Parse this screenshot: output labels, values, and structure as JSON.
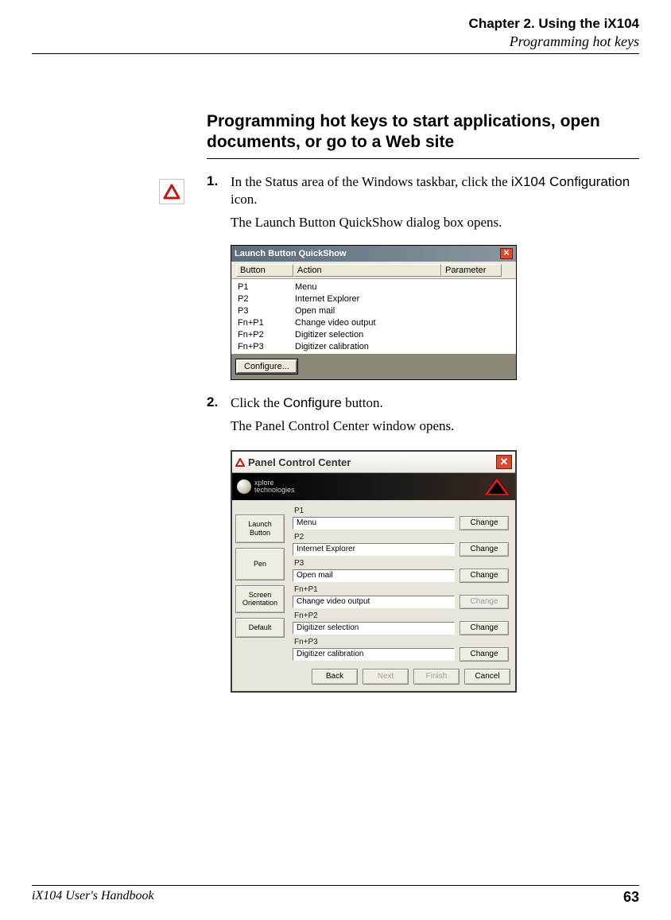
{
  "header": {
    "chapter": "Chapter 2. Using the iX104",
    "section": "Programming hot keys"
  },
  "title": "Programming hot keys to start applications, open documents, or go to a Web site",
  "steps": {
    "s1": {
      "num": "1.",
      "text_a": "In the Status area of the Windows taskbar, click the ",
      "text_b": "iX104 Configuration",
      "text_c": " icon.",
      "result": "The Launch Button QuickShow dialog box opens."
    },
    "s2": {
      "num": "2.",
      "text_a": "Click the ",
      "text_b": "Configure",
      "text_c": " button.",
      "result": "The Panel Control Center window opens."
    }
  },
  "quickshow": {
    "title": "Launch Button QuickShow",
    "columns": {
      "button": "Button",
      "action": "Action",
      "parameter": "Parameter"
    },
    "rows": [
      {
        "button": "P1",
        "action": "Menu"
      },
      {
        "button": "P2",
        "action": "Internet Explorer"
      },
      {
        "button": "P3",
        "action": "Open mail"
      },
      {
        "button": "Fn+P1",
        "action": "Change video output"
      },
      {
        "button": "Fn+P2",
        "action": "Digitizer selection"
      },
      {
        "button": "Fn+P3",
        "action": "Digitizer calibration"
      }
    ],
    "configure": "Configure..."
  },
  "pcc": {
    "title": "Panel Control Center",
    "banner": "xplore\ntechnologies",
    "sidebar": {
      "launch": "Launch\nButton",
      "pen": "Pen",
      "screen": "Screen\nOrientation",
      "default": "Default"
    },
    "rows": [
      {
        "label": "P1",
        "value": "Menu",
        "change": "Change",
        "enabled": true
      },
      {
        "label": "P2",
        "value": "Internet Explorer",
        "change": "Change",
        "enabled": true
      },
      {
        "label": "P3",
        "value": "Open mail",
        "change": "Change",
        "enabled": true
      },
      {
        "label": "Fn+P1",
        "value": "Change video output",
        "change": "Change",
        "enabled": false
      },
      {
        "label": "Fn+P2",
        "value": "Digitizer selection",
        "change": "Change",
        "enabled": true
      },
      {
        "label": "Fn+P3",
        "value": "Digitizer calibration",
        "change": "Change",
        "enabled": true
      }
    ],
    "footer": {
      "back": "Back",
      "next": "Next",
      "finish": "Finish",
      "cancel": "Cancel"
    }
  },
  "footer": {
    "handbook": "iX104 User's Handbook",
    "page": "63"
  }
}
